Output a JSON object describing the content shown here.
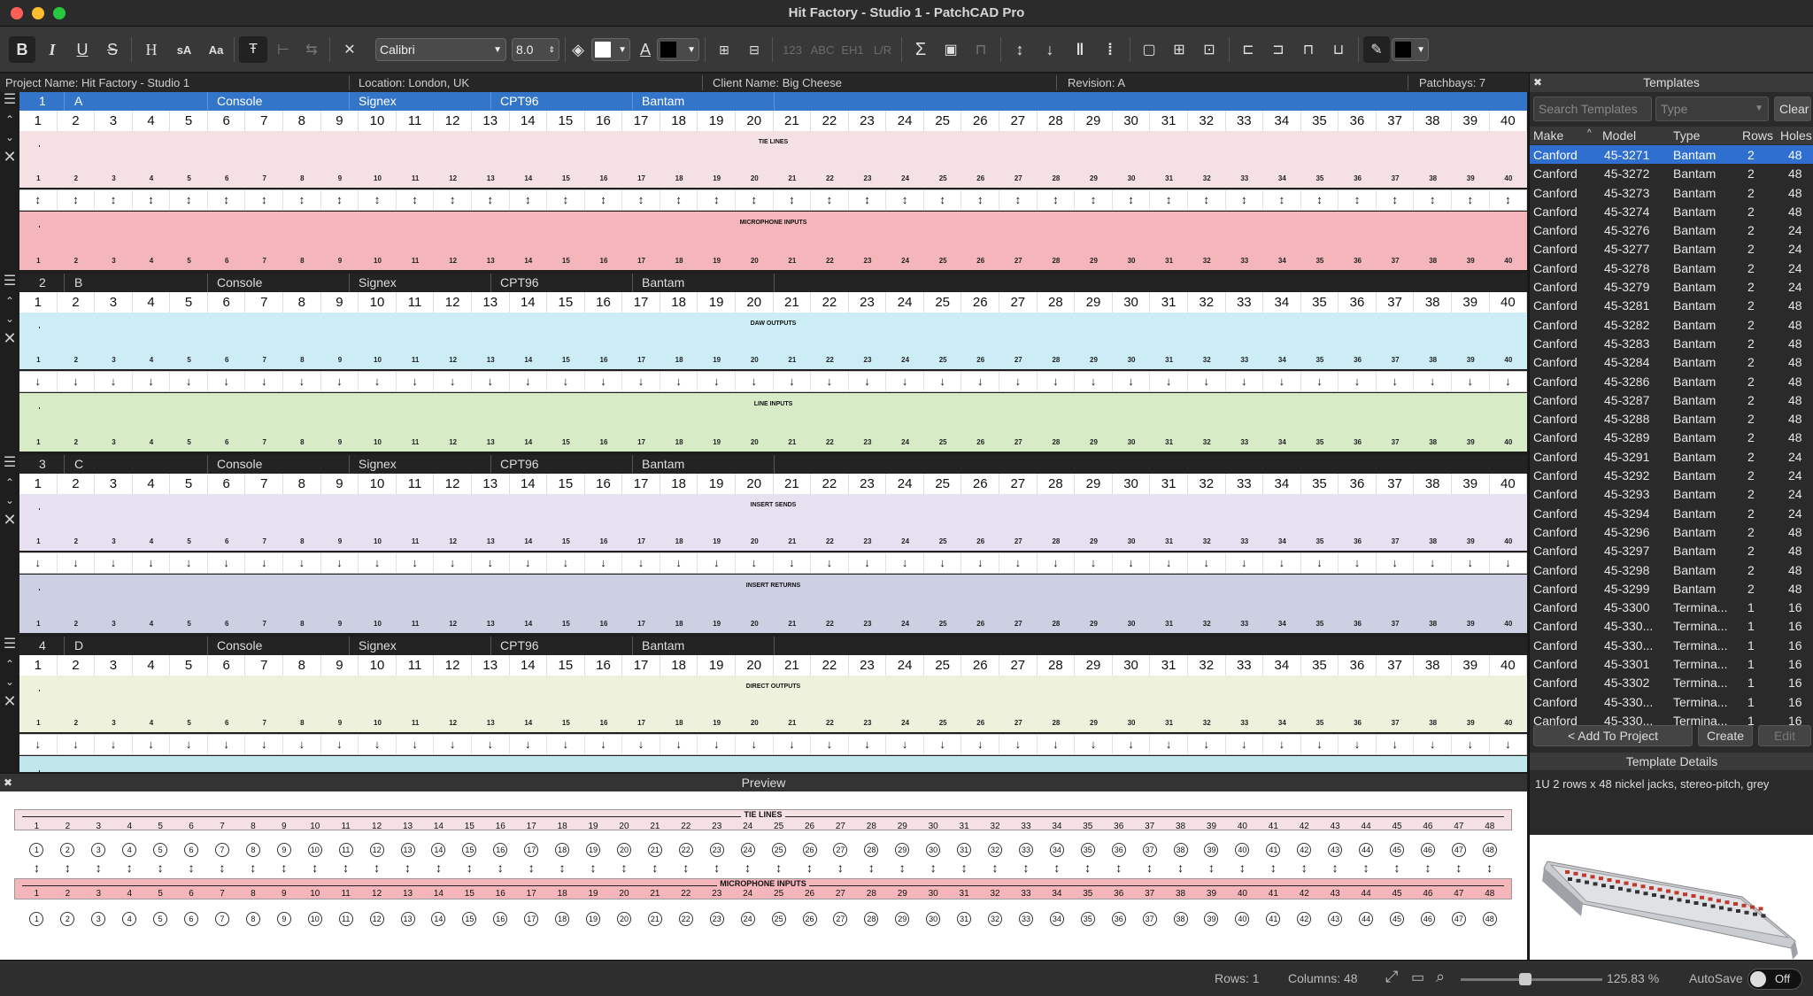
{
  "window": {
    "title": "Hit Factory - Studio 1 - PatchCAD Pro"
  },
  "toolbar": {
    "font": "Calibri",
    "size": "8.0",
    "bold": "B",
    "italic": "I",
    "underline": "U",
    "strike": "S",
    "heading": "H",
    "smallcaps": "sA",
    "capsize": "Aa",
    "num123": "123",
    "abc": "ABC",
    "eh1": "EH1",
    "lr": "L/R",
    "sigma": "Σ"
  },
  "info": {
    "project": "Project Name: Hit Factory - Studio 1",
    "location": "Location: London, UK",
    "client": "Client Name: Big Cheese",
    "revision": "Revision: A",
    "patchbays": "Patchbays: 7"
  },
  "columns": [
    "1",
    "2",
    "3",
    "4",
    "5",
    "6",
    "7",
    "8",
    "9",
    "10",
    "11",
    "12",
    "13",
    "14",
    "15",
    "16",
    "17",
    "18",
    "19",
    "20",
    "21",
    "22",
    "23",
    "24",
    "25",
    "26",
    "27",
    "28",
    "29",
    "30",
    "31",
    "32",
    "33",
    "34",
    "35",
    "36",
    "37",
    "38",
    "39",
    "40"
  ],
  "bays": [
    {
      "num": "1",
      "name": "A",
      "dest": "Console",
      "maker": "Signex",
      "model": "CPT96",
      "type": "Bantam",
      "top": "TIE LINES",
      "bottom": "MICROPHONE INPUTS",
      "arrow": "↕"
    },
    {
      "num": "2",
      "name": "B",
      "dest": "Console",
      "maker": "Signex",
      "model": "CPT96",
      "type": "Bantam",
      "top": "DAW OUTPUTS",
      "bottom": "LINE INPUTS",
      "arrow": "↓"
    },
    {
      "num": "3",
      "name": "C",
      "dest": "Console",
      "maker": "Signex",
      "model": "CPT96",
      "type": "Bantam",
      "top": "INSERT SENDS",
      "bottom": "INSERT RETURNS",
      "arrow": "↓"
    },
    {
      "num": "4",
      "name": "D",
      "dest": "Console",
      "maker": "Signex",
      "model": "CPT96",
      "type": "Bantam",
      "top": "DIRECT OUTPUTS",
      "bottom": "",
      "arrow": "↓"
    }
  ],
  "colors": {
    "bay1top": "#f5e1e3",
    "bay1bot": "#f4b6ba",
    "bay2top": "#ccecf6",
    "bay2bot": "#d7ebc7",
    "bay3top": "#e6e0f1",
    "bay3bot": "#cdcfe3",
    "bay4top": "#eef1dc",
    "bay4bot": "#bfe7ec",
    "accent": "#3375c9"
  },
  "preview": {
    "title": "Preview",
    "top": "TIE LINES",
    "bottom": "MICROPHONE INPUTS",
    "count": 48
  },
  "templates": {
    "title": "Templates",
    "search_placeholder": "Search Templates",
    "type_placeholder": "Type",
    "clear": "Clear",
    "headers": {
      "make": "Make",
      "model": "Model",
      "type": "Type",
      "rows": "Rows",
      "holes": "Holes"
    },
    "rows": [
      [
        "Canford",
        "45-3271",
        "Bantam",
        "2",
        "48"
      ],
      [
        "Canford",
        "45-3272",
        "Bantam",
        "2",
        "48"
      ],
      [
        "Canford",
        "45-3273",
        "Bantam",
        "2",
        "48"
      ],
      [
        "Canford",
        "45-3274",
        "Bantam",
        "2",
        "48"
      ],
      [
        "Canford",
        "45-3276",
        "Bantam",
        "2",
        "24"
      ],
      [
        "Canford",
        "45-3277",
        "Bantam",
        "2",
        "24"
      ],
      [
        "Canford",
        "45-3278",
        "Bantam",
        "2",
        "24"
      ],
      [
        "Canford",
        "45-3279",
        "Bantam",
        "2",
        "24"
      ],
      [
        "Canford",
        "45-3281",
        "Bantam",
        "2",
        "48"
      ],
      [
        "Canford",
        "45-3282",
        "Bantam",
        "2",
        "48"
      ],
      [
        "Canford",
        "45-3283",
        "Bantam",
        "2",
        "48"
      ],
      [
        "Canford",
        "45-3284",
        "Bantam",
        "2",
        "48"
      ],
      [
        "Canford",
        "45-3286",
        "Bantam",
        "2",
        "48"
      ],
      [
        "Canford",
        "45-3287",
        "Bantam",
        "2",
        "48"
      ],
      [
        "Canford",
        "45-3288",
        "Bantam",
        "2",
        "48"
      ],
      [
        "Canford",
        "45-3289",
        "Bantam",
        "2",
        "48"
      ],
      [
        "Canford",
        "45-3291",
        "Bantam",
        "2",
        "24"
      ],
      [
        "Canford",
        "45-3292",
        "Bantam",
        "2",
        "24"
      ],
      [
        "Canford",
        "45-3293",
        "Bantam",
        "2",
        "24"
      ],
      [
        "Canford",
        "45-3294",
        "Bantam",
        "2",
        "24"
      ],
      [
        "Canford",
        "45-3296",
        "Bantam",
        "2",
        "48"
      ],
      [
        "Canford",
        "45-3297",
        "Bantam",
        "2",
        "48"
      ],
      [
        "Canford",
        "45-3298",
        "Bantam",
        "2",
        "48"
      ],
      [
        "Canford",
        "45-3299",
        "Bantam",
        "2",
        "48"
      ],
      [
        "Canford",
        "45-3300",
        "Termina...",
        "1",
        "16"
      ],
      [
        "Canford",
        "45-330...",
        "Termina...",
        "1",
        "16"
      ],
      [
        "Canford",
        "45-330...",
        "Termina...",
        "1",
        "16"
      ],
      [
        "Canford",
        "45-3301",
        "Termina...",
        "1",
        "16"
      ],
      [
        "Canford",
        "45-3302",
        "Termina...",
        "1",
        "16"
      ],
      [
        "Canford",
        "45-330...",
        "Termina...",
        "1",
        "16"
      ],
      [
        "Canford",
        "45-330...",
        "Termina...",
        "1",
        "16"
      ]
    ],
    "add": "< Add To Project",
    "create": "Create",
    "edit": "Edit",
    "details_title": "Template Details",
    "details_text": "1U 2 rows x 48 nickel jacks, stereo-pitch, grey"
  },
  "status": {
    "rows": "Rows: 1",
    "columns": "Columns: 48",
    "zoom": "125.83 %",
    "autosave": "AutoSave",
    "off": "Off"
  }
}
